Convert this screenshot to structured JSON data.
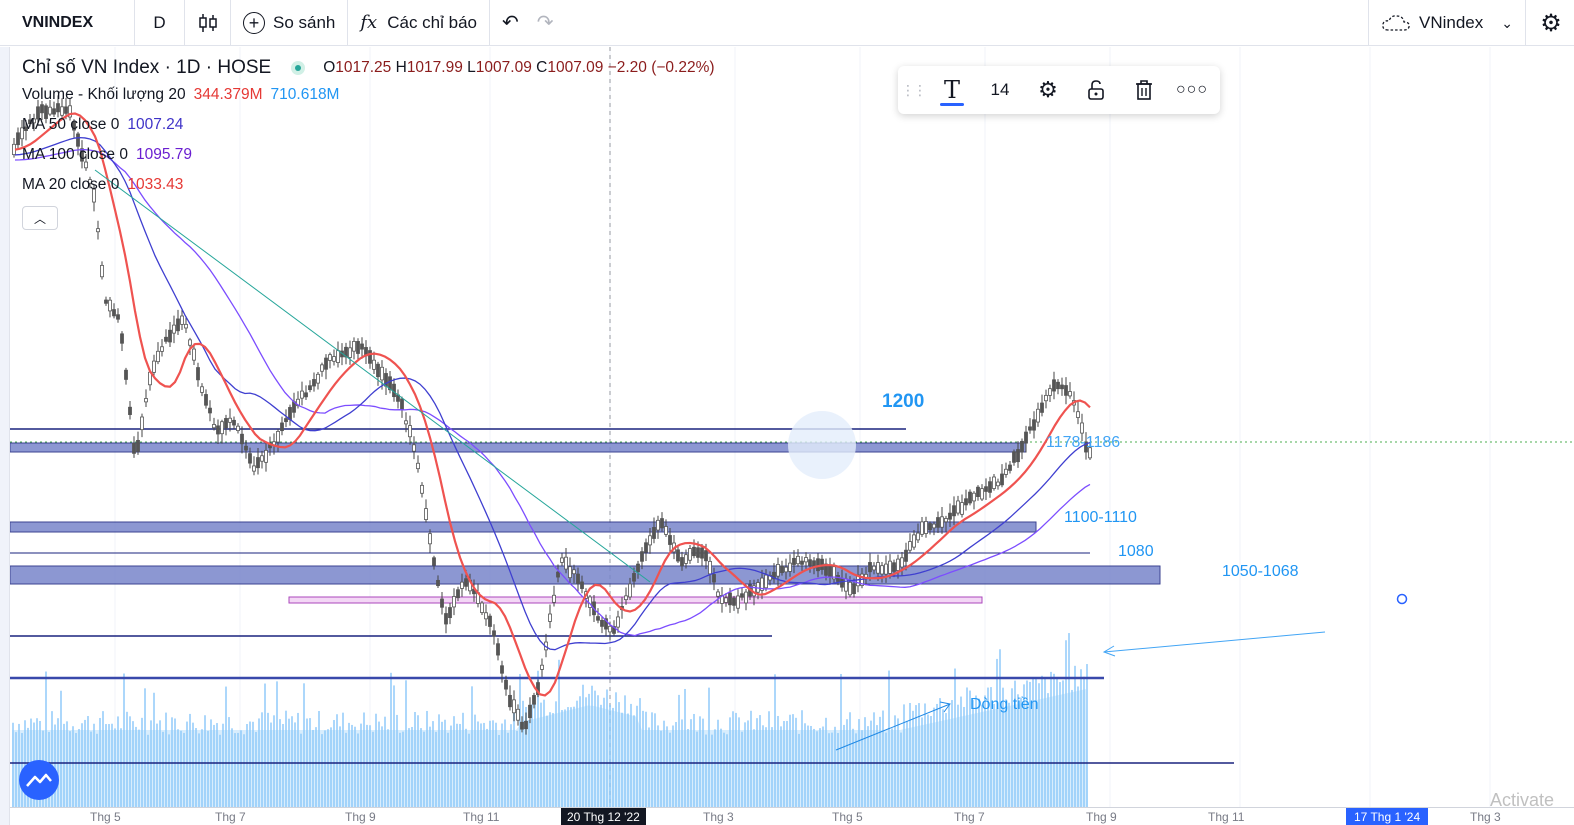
{
  "toolbar": {
    "symbol": "VNINDEX",
    "interval": "D",
    "compare_label": "So sánh",
    "indicators_label": "Các chỉ báo",
    "layout_name": "VNindex"
  },
  "legend": {
    "title": "Chỉ số VN Index · 1D · HOSE",
    "o_label": "O",
    "o_value": "1017.25",
    "h_label": "H",
    "h_value": "1017.99",
    "l_label": "L",
    "l_value": "1007.09",
    "c_label": "C",
    "c_value": "1007.09",
    "change": "−2.20 (−0.22%)",
    "volume_label": "Volume - Khối lượng 20",
    "volume_value1": "344.379M",
    "volume_value2": "710.618M",
    "ma50_label": "MA 50 close 0",
    "ma50_value": "1007.24",
    "ma100_label": "MA 100 close 0",
    "ma100_value": "1095.79",
    "ma20_label": "MA 20 close 0",
    "ma20_value": "1033.43"
  },
  "drawing_toolbar": {
    "font_size": "14"
  },
  "annotations": {
    "level_1200": "1200",
    "level_1178": "1178-1186",
    "level_1100": "1100-1110",
    "level_1080": "1080",
    "level_1050": "1050-1068",
    "money_flow": "Dòng tiền"
  },
  "time_axis": {
    "labels": [
      "Thg 5",
      "Thg 7",
      "Thg 9",
      "Thg 11",
      "Thg 3",
      "Thg 5",
      "Thg 7",
      "Thg 9",
      "Thg 11",
      "Thg 3"
    ],
    "crosshair_label": "20 Thg 12 '22",
    "right_label": "17 Thg 1 '24"
  },
  "watermark": "Activate",
  "colors": {
    "ma20": "#ef5350",
    "ma50": "#3f3fd0",
    "ma100": "#7c4dff",
    "zone_fill": "#7986cb",
    "volume": "#90caf9",
    "trend_line": "#26a69a",
    "annotation": "#2196f3"
  },
  "icons": [
    "candlestick-icon",
    "plus-circle-icon",
    "function-icon",
    "undo-icon",
    "redo-icon",
    "cloud-icon",
    "chevron-down-icon",
    "gear-icon",
    "text-icon",
    "lock-icon",
    "trash-icon",
    "more-icon",
    "drag-handle-icon",
    "collapse-icon",
    "tradingview-logo-icon"
  ]
}
